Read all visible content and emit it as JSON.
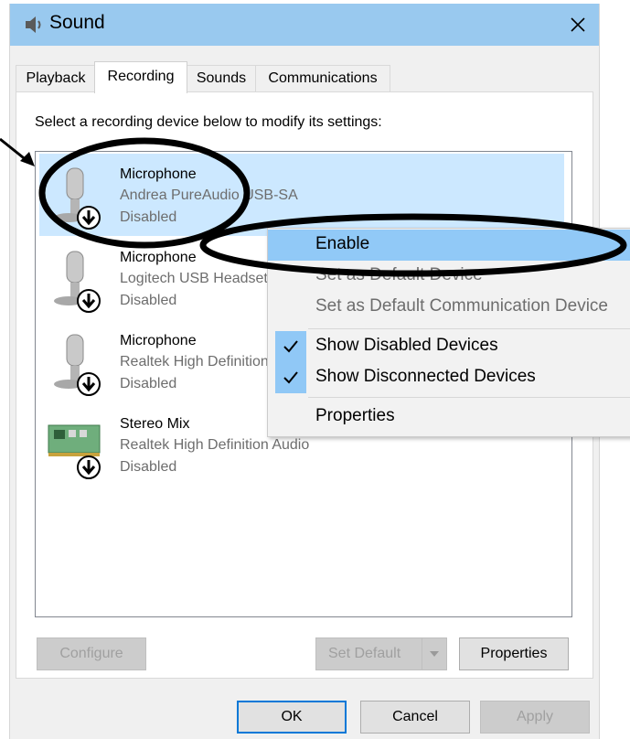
{
  "window": {
    "title": "Sound"
  },
  "tabs": [
    {
      "label": "Playback",
      "active": false
    },
    {
      "label": "Recording",
      "active": true
    },
    {
      "label": "Sounds",
      "active": false
    },
    {
      "label": "Communications",
      "active": false
    }
  ],
  "instruction": "Select a recording device below to modify its settings:",
  "devices": [
    {
      "name": "Microphone",
      "description": "Andrea PureAudio USB-SA",
      "status": "Disabled",
      "icon": "microphone-icon",
      "selected": true
    },
    {
      "name": "Microphone",
      "description": "Logitech USB Headset",
      "status": "Disabled",
      "icon": "microphone-icon",
      "selected": false
    },
    {
      "name": "Microphone",
      "description": "Realtek High Definition Audio",
      "status": "Disabled",
      "icon": "microphone-icon",
      "selected": false
    },
    {
      "name": "Stereo Mix",
      "description": "Realtek High Definition Audio",
      "status": "Disabled",
      "icon": "sound-card-icon",
      "selected": false
    }
  ],
  "context_menu": {
    "items": [
      {
        "label": "Enable",
        "state": "highlighted"
      },
      {
        "label": "Set as Default Device",
        "state": "disabled"
      },
      {
        "label": "Set as Default Communication Device",
        "state": "disabled"
      },
      {
        "label": "Show Disabled Devices",
        "checked": true
      },
      {
        "label": "Show Disconnected Devices",
        "checked": true
      },
      {
        "label": "Properties"
      }
    ]
  },
  "panel_buttons": {
    "configure": "Configure",
    "set_default": "Set Default",
    "properties": "Properties"
  },
  "dialog_buttons": {
    "ok": "OK",
    "cancel": "Cancel",
    "apply": "Apply"
  },
  "colors": {
    "titlebar": "#99c9ef",
    "selection": "#cce8ff",
    "menu_highlight": "#91c9f7",
    "default_button_border": "#0078d7"
  }
}
